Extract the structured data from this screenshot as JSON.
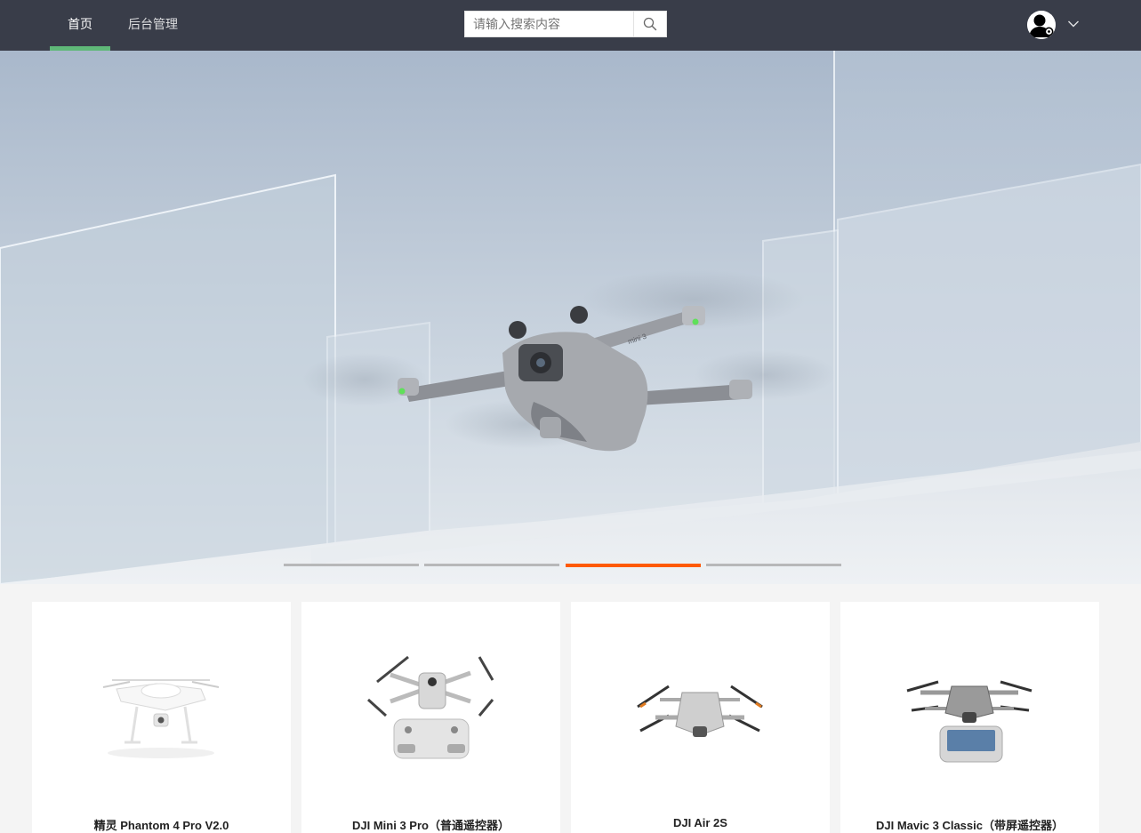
{
  "nav": {
    "items": [
      {
        "label": "首页",
        "active": true
      },
      {
        "label": "后台管理",
        "active": false
      }
    ],
    "search": {
      "placeholder": "请输入搜索内容",
      "icon": "search-icon"
    },
    "user": {
      "avatar_icon": "user-avatar-icon",
      "dropdown_icon": "chevron-down-icon"
    }
  },
  "banner": {
    "slide_count": 4,
    "active_index": 2,
    "drone_label": "mini 3"
  },
  "products": [
    {
      "title": "精灵 Phantom 4 Pro V2.0"
    },
    {
      "title": "DJI Mini 3 Pro（普通遥控器）"
    },
    {
      "title": "DJI Air 2S"
    },
    {
      "title": "DJI Mavic 3 Classic（带屏遥控器）"
    }
  ],
  "colors": {
    "nav_bg": "#393d49",
    "nav_active_bar": "#5fb878",
    "indicator_active": "#ff5a00",
    "indicator_inactive": "#aaaaaa",
    "page_bg": "#f4f4f4"
  }
}
